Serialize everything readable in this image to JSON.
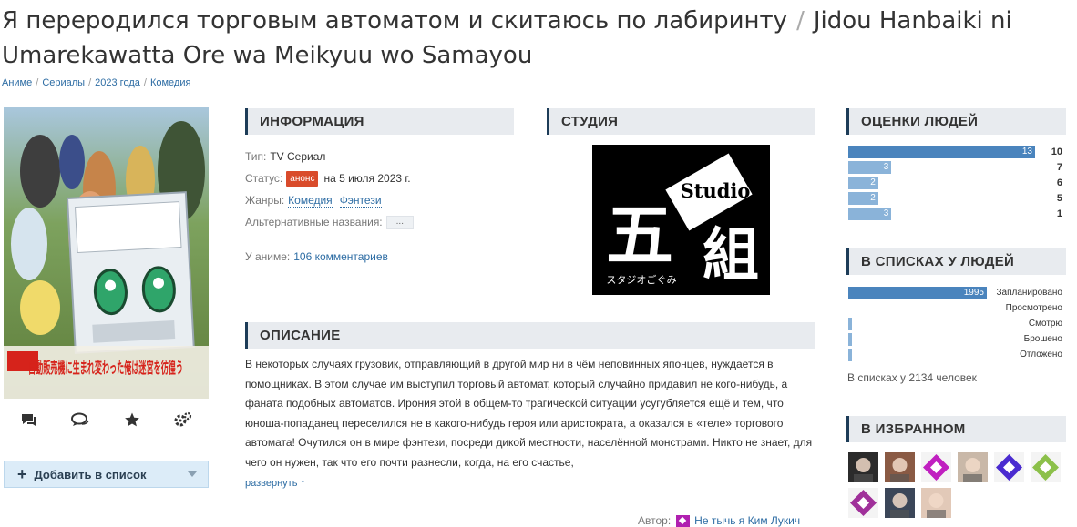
{
  "title": {
    "ru": "Я переродился торговым автоматом и скитаюсь по лабиринту",
    "separator": "/",
    "romaji": "Jidou Hanbaiki ni Umarekawatta Ore wa Meikyuu wo Samayou"
  },
  "breadcrumbs": [
    "Аниме",
    "Сериалы",
    "2023 года",
    "Комедия"
  ],
  "poster": {
    "logo_text": "自動販売機に生まれ変わった俺は迷宮を彷徨う",
    "colors": {
      "bg": "#6d8f4b",
      "machine": "#e9eef2",
      "eyes": "#2fa56a",
      "logo_red": "#d6231b"
    }
  },
  "actions": [
    "comment-icon",
    "reviews-icon",
    "star-icon",
    "settings-icon"
  ],
  "add_list": {
    "label": "Добавить в список"
  },
  "info": {
    "heading": "ИНФОРМАЦИЯ",
    "type_key": "Тип:",
    "type_val": "TV Сериал",
    "status_key": "Статус:",
    "status_badge": "анонс",
    "status_val": "на 5 июля 2023 г.",
    "genres_key": "Жанры:",
    "genres": [
      "Комедия",
      "Фэнтези"
    ],
    "alt_key": "Альтернативные названия:",
    "alt_btn": "...",
    "comments_key": "У аниме:",
    "comments_val": "106 комментариев"
  },
  "studio": {
    "heading": "СТУДИЯ",
    "logo_word": "Studio",
    "logo_main_left": "五",
    "logo_main_right": "組",
    "logo_kana": "スタジオごぐみ"
  },
  "description": {
    "heading": "ОПИСАНИЕ",
    "text": "В некоторых случаях грузовик, отправляющий в другой мир ни в чём неповинных японцев, нуждается в помощниках. В этом случае им выступил торговый автомат, который случайно придавил не кого-нибудь, а фаната подобных автоматов. Ирония этой в общем-то трагической ситуации усугубляется ещё и тем, что юноша-попаданец переселился не в какого-нибудь героя или аристократа, а оказался в «теле» торгового автомата! Очутился он в мире фэнтези, посреди дикой местности, населённой монстрами. Никто не знает, для чего он нужен, так что его почти разнесли, когда, на его счастье,",
    "expand": "развернуть ↑",
    "author_key": "Автор:",
    "author_name": "Не тычь я Ким Лукич"
  },
  "ratings": {
    "heading": "ОЦЕНКИ ЛЮДЕЙ",
    "max": 13,
    "rows": [
      {
        "score": "10",
        "count": 13
      },
      {
        "score": "7",
        "count": 3
      },
      {
        "score": "6",
        "count": 2
      },
      {
        "score": "5",
        "count": 2
      },
      {
        "score": "1",
        "count": 3
      }
    ]
  },
  "lists": {
    "heading": "В СПИСКАХ У ЛЮДЕЙ",
    "max": 1995,
    "rows": [
      {
        "label": "Запланировано",
        "count": 1995,
        "count_text": "1995"
      },
      {
        "label": "Просмотрено",
        "count": 0,
        "count_text": ""
      },
      {
        "label": "Смотрю",
        "count": 40,
        "count_text": ""
      },
      {
        "label": "Брошено",
        "count": 40,
        "count_text": ""
      },
      {
        "label": "Отложено",
        "count": 40,
        "count_text": ""
      }
    ],
    "total": "В списках у 2134 человек"
  },
  "favorites": {
    "heading": "В ИЗБРАННОМ",
    "avatars": [
      {
        "kind": "photo",
        "color": "#2b2b2b"
      },
      {
        "kind": "photo",
        "color": "#8a5a44"
      },
      {
        "kind": "pattern",
        "color": "#c020c0"
      },
      {
        "kind": "photo",
        "color": "#c9b8a8"
      },
      {
        "kind": "pattern",
        "color": "#4a2bd0"
      },
      {
        "kind": "pattern",
        "color": "#8cc04a"
      },
      {
        "kind": "pattern",
        "color": "#a0309a"
      },
      {
        "kind": "photo",
        "color": "#3b4658"
      },
      {
        "kind": "photo",
        "color": "#e2c9b8"
      }
    ]
  }
}
